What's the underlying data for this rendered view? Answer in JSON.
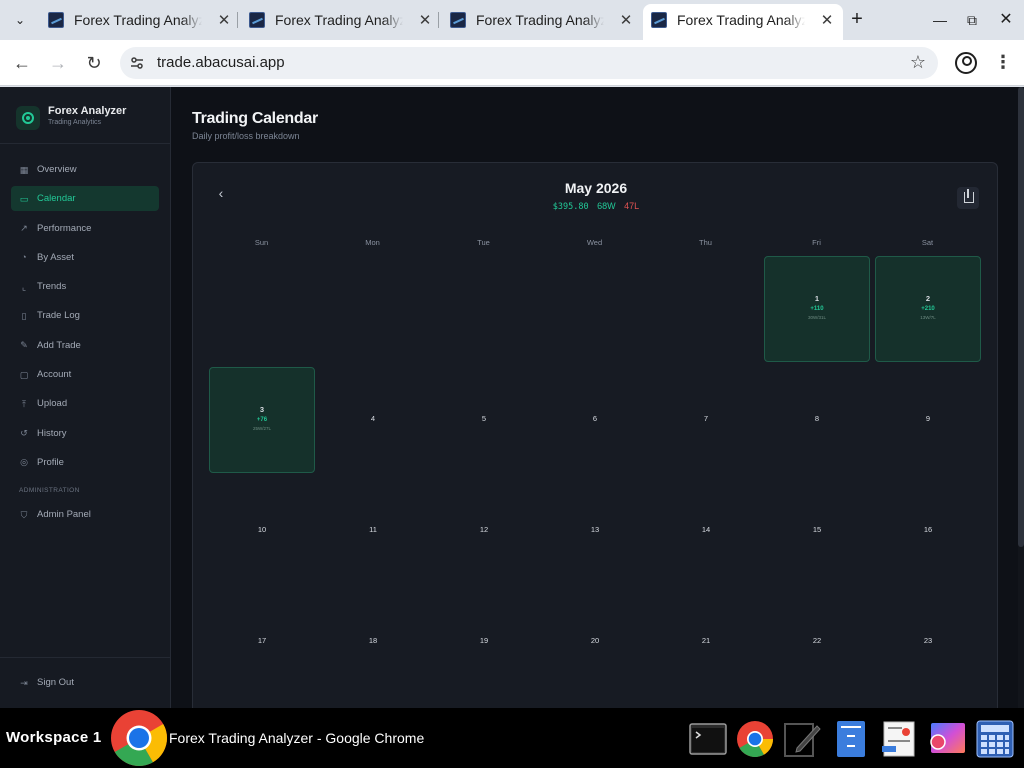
{
  "browser": {
    "tabs": [
      {
        "title": "Forex Trading Analyzer"
      },
      {
        "title": "Forex Trading Analyzer"
      },
      {
        "title": "Forex Trading Analyzer"
      },
      {
        "title": "Forex Trading Analyzer",
        "active": true
      }
    ],
    "url": "trade.abacusai.app"
  },
  "sidebar": {
    "brand_name": "Forex Analyzer",
    "brand_sub": "Trading Analytics",
    "items": [
      {
        "label": "Overview",
        "icon": "grid-icon"
      },
      {
        "label": "Calendar",
        "icon": "calendar-icon",
        "active": true
      },
      {
        "label": "Performance",
        "icon": "trend-up-icon"
      },
      {
        "label": "By Asset",
        "icon": "pie-chart-icon"
      },
      {
        "label": "Trends",
        "icon": "line-chart-icon"
      },
      {
        "label": "Trade Log",
        "icon": "file-list-icon"
      },
      {
        "label": "Add Trade",
        "icon": "pencil-icon"
      },
      {
        "label": "Account",
        "icon": "wallet-icon"
      },
      {
        "label": "Upload",
        "icon": "upload-icon"
      },
      {
        "label": "History",
        "icon": "history-icon"
      },
      {
        "label": "Profile",
        "icon": "user-icon"
      }
    ],
    "admin_section": "ADMINISTRATION",
    "admin_item": {
      "label": "Admin Panel",
      "icon": "shield-icon"
    },
    "signout": {
      "label": "Sign Out",
      "icon": "logout-icon"
    }
  },
  "page": {
    "title": "Trading Calendar",
    "subtitle": "Daily profit/loss breakdown"
  },
  "calendar": {
    "month": "May 2026",
    "total_pnl": "$395.80",
    "wins": "68W",
    "losses": "47L",
    "weekdays": [
      "Sun",
      "Mon",
      "Tue",
      "Wed",
      "Thu",
      "Fri",
      "Sat"
    ],
    "days": [
      {
        "day": "1",
        "pnl": "+110",
        "wl": "30W/31L"
      },
      {
        "day": "2",
        "pnl": "+210",
        "wl": "13W/7L"
      },
      {
        "day": "3",
        "pnl": "+76",
        "wl": "25W/27L"
      },
      {
        "day": "4"
      },
      {
        "day": "5"
      },
      {
        "day": "6"
      },
      {
        "day": "7"
      },
      {
        "day": "8"
      },
      {
        "day": "9"
      },
      {
        "day": "10"
      },
      {
        "day": "11"
      },
      {
        "day": "12"
      },
      {
        "day": "13"
      },
      {
        "day": "14"
      },
      {
        "day": "15"
      },
      {
        "day": "16"
      },
      {
        "day": "17"
      },
      {
        "day": "18"
      },
      {
        "day": "19"
      },
      {
        "day": "20"
      },
      {
        "day": "21"
      },
      {
        "day": "22"
      },
      {
        "day": "23"
      }
    ]
  },
  "taskbar": {
    "workspace": "Workspace 1",
    "active_window": "Forex Trading Analyzer - Google Chrome"
  },
  "colors": {
    "accent": "#22c997",
    "loss": "#e05252",
    "background": "#0e1117",
    "sidebar": "#161a22"
  }
}
